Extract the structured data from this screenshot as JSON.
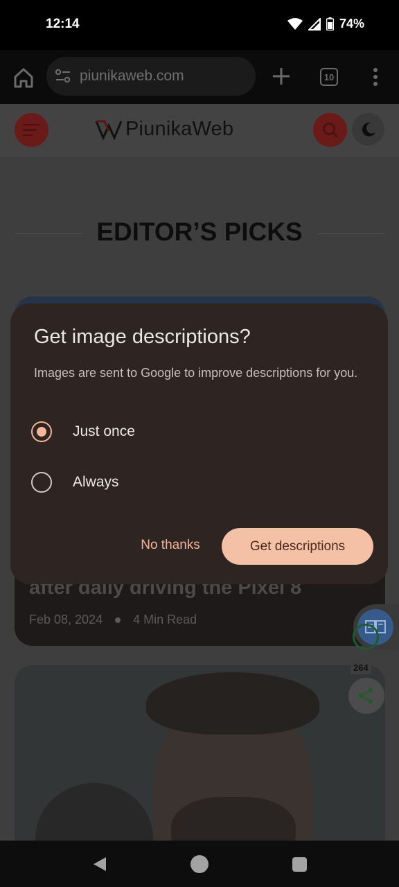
{
  "status_bar": {
    "time": "12:14",
    "battery": "74%"
  },
  "browser": {
    "url": "piunikaweb.com",
    "tab_count": "10"
  },
  "site": {
    "logo_text": "PiunikaWeb",
    "section_title": "EDITOR’S PICKS",
    "card1": {
      "title": "after daily driving the Pixel 8",
      "date": "Feb 08, 2024",
      "read_time": "4 Min Read"
    },
    "share_count": "264"
  },
  "dialog": {
    "title": "Get image descriptions?",
    "body": "Images are sent to Google to improve descriptions for you.",
    "options": [
      {
        "label": "Just once",
        "selected": true
      },
      {
        "label": "Always",
        "selected": false
      }
    ],
    "secondary_button": "No thanks",
    "primary_button": "Get descriptions"
  },
  "colors": {
    "accent": "#f4b59a",
    "dialog_bg": "#2e2421",
    "brand_red": "#b11f1f"
  },
  "icons": [
    "home-icon",
    "site-settings-icon",
    "plus-icon",
    "tab-switcher-icon",
    "more-vert-icon",
    "menu-icon",
    "search-icon",
    "moon-icon",
    "share-icon",
    "image-description-icon",
    "wifi-icon",
    "signal-icon",
    "battery-icon",
    "back-icon",
    "nav-home-icon",
    "recents-icon"
  ]
}
